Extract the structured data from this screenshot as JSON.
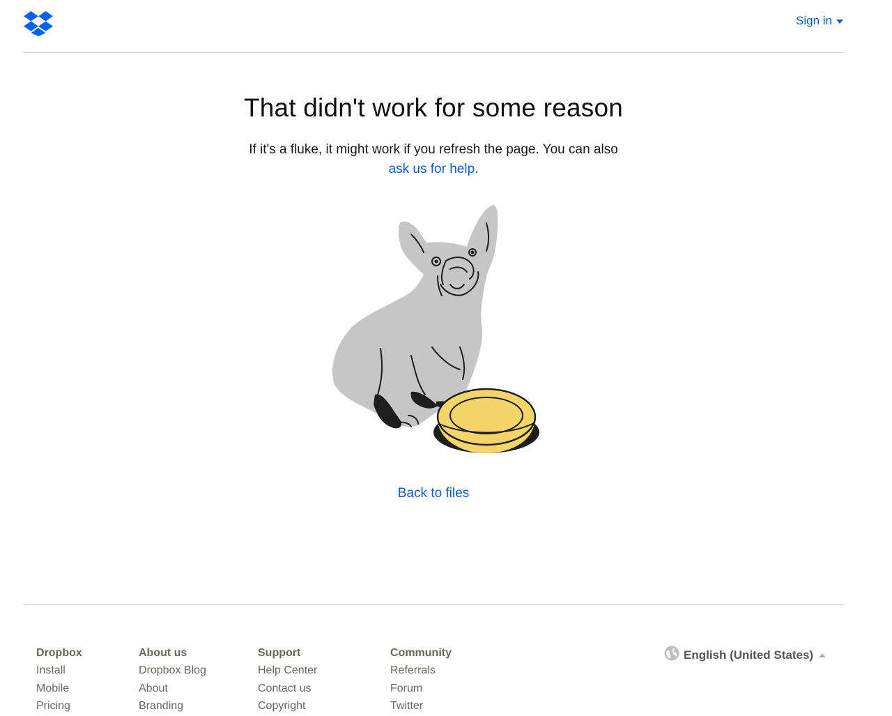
{
  "header": {
    "logo_icon": "dropbox-logo-icon",
    "sign_in_label": "Sign in",
    "brand_color": "#0061FE",
    "link_color": "#0D5CD6"
  },
  "main": {
    "headline": "That didn't work for some reason",
    "message_line1": "If it's a fluke, it might work if you refresh the page. You can also",
    "help_link": "ask us for help.",
    "illustration": "dog-with-empty-bowl-illustration",
    "back_link": "Back to files"
  },
  "footer": {
    "columns": [
      {
        "heading": "Dropbox",
        "items": [
          "Install",
          "Mobile",
          "Pricing"
        ]
      },
      {
        "heading": "About us",
        "items": [
          "Dropbox Blog",
          "About",
          "Branding"
        ]
      },
      {
        "heading": "Support",
        "items": [
          "Help Center",
          "Contact us",
          "Copyright"
        ]
      },
      {
        "heading": "Community",
        "items": [
          "Referrals",
          "Forum",
          "Twitter"
        ]
      }
    ],
    "language": "English (United States)",
    "language_icon": "globe-icon"
  }
}
